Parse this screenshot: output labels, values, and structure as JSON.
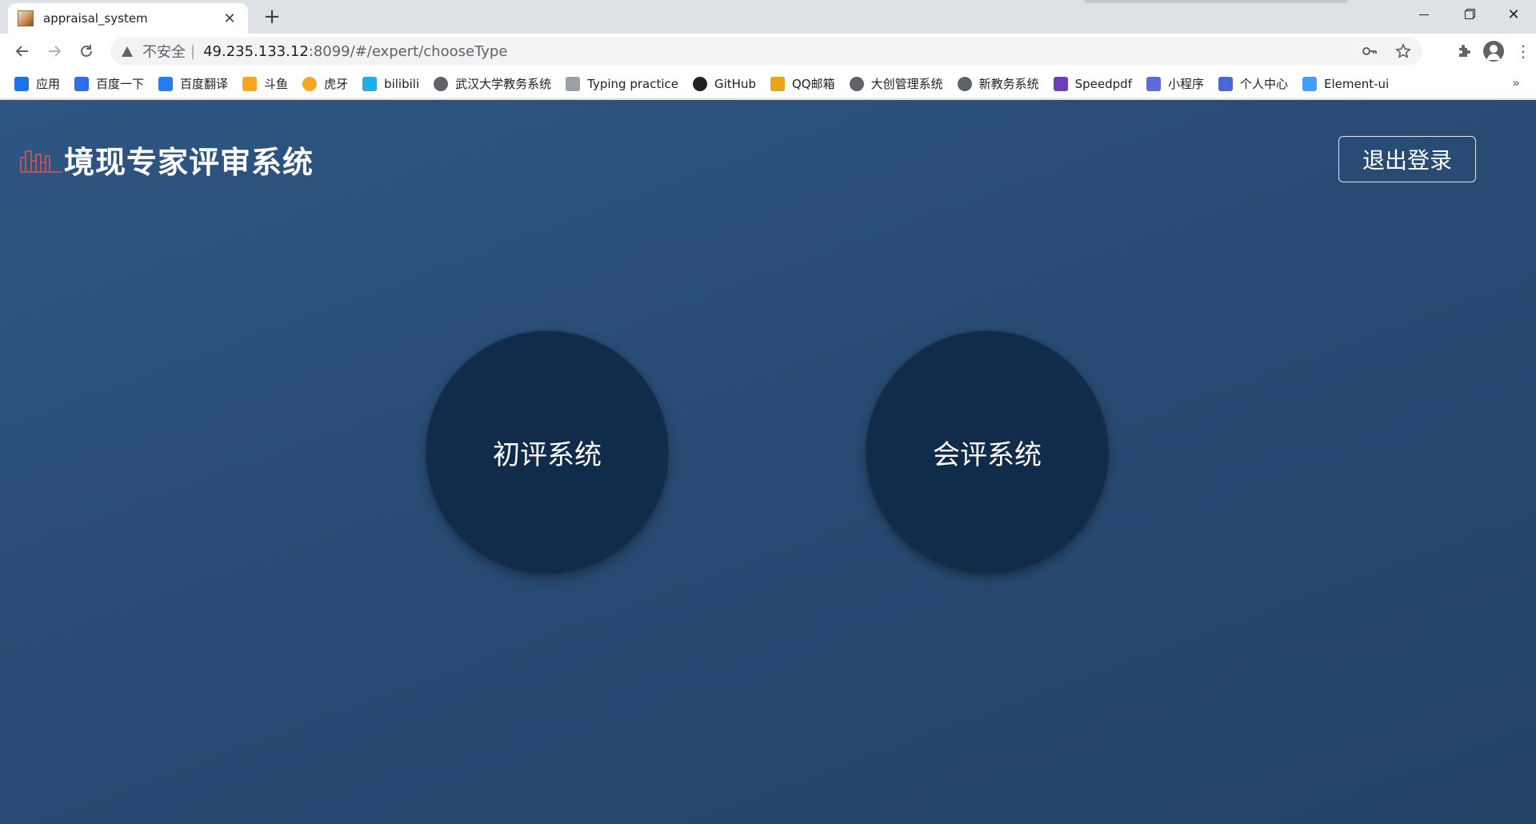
{
  "browser": {
    "tab_title": "appraisal_system",
    "tab_close": "✕",
    "new_tab": "+",
    "security_label": "不安全",
    "separator": "|",
    "url_host": "49.235.133.12",
    "url_rest": ":8099/#/expert/chooseType",
    "bookmarks": [
      {
        "label": "应用",
        "icon": "apps-grid-icon",
        "color": "#1a73e8",
        "glyph": "⋮⋮"
      },
      {
        "label": "百度一下",
        "icon": "baidu-paw-icon",
        "color": "#2f6ee6",
        "glyph": "✻"
      },
      {
        "label": "百度翻译",
        "icon": "translate-icon",
        "color": "#2b7bf0",
        "glyph": "译"
      },
      {
        "label": "斗鱼",
        "icon": "douyu-icon",
        "color": "#f6a623",
        "glyph": "✦"
      },
      {
        "label": "虎牙",
        "icon": "huya-icon",
        "color": "#f5a623",
        "glyph": "●"
      },
      {
        "label": "bilibili",
        "icon": "bilibili-icon",
        "color": "#23ade5",
        "glyph": "▣"
      },
      {
        "label": "武汉大学教务系统",
        "icon": "globe-icon",
        "color": "#5f6368",
        "glyph": "●"
      },
      {
        "label": "Typing practice",
        "icon": "typing-doc-icon",
        "color": "#9aa0a6",
        "glyph": "▤"
      },
      {
        "label": "GitHub",
        "icon": "github-icon",
        "color": "#202124",
        "glyph": "●"
      },
      {
        "label": "QQ邮箱",
        "icon": "qqmail-icon",
        "color": "#e8a317",
        "glyph": "◎"
      },
      {
        "label": "大创管理系统",
        "icon": "globe-icon",
        "color": "#5f6368",
        "glyph": "●"
      },
      {
        "label": "新教务系统",
        "icon": "globe-icon",
        "color": "#5f6368",
        "glyph": "●"
      },
      {
        "label": "Speedpdf",
        "icon": "speedpdf-icon",
        "color": "#6a3fb5",
        "glyph": "➤"
      },
      {
        "label": "小程序",
        "icon": "miniprogram-icon",
        "color": "#5b6bd8",
        "glyph": "§"
      },
      {
        "label": "个人中心",
        "icon": "profile-center-icon",
        "color": "#4a67d6",
        "glyph": "卍"
      },
      {
        "label": "Element-ui",
        "icon": "element-ui-icon",
        "color": "#409eff",
        "glyph": "⬢"
      }
    ],
    "bookmarks_more": "»"
  },
  "page": {
    "title": "境现专家评审系统",
    "logout_label": "退出登录",
    "options": [
      {
        "label": "初评系统"
      },
      {
        "label": "会评系统"
      }
    ],
    "background_color": "#2a4f79",
    "circle_color": "#102c4a",
    "logo_color": "#d9545a"
  }
}
